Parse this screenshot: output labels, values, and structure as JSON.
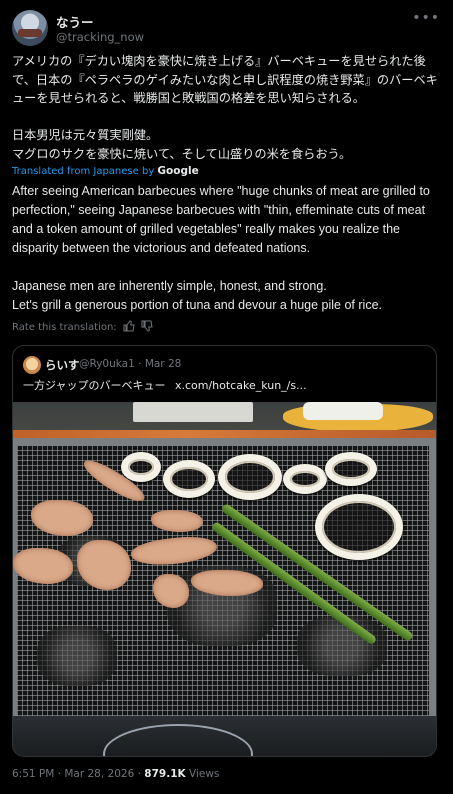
{
  "author": {
    "display_name": "なうー",
    "handle": "@tracking_now",
    "more_icon": "ellipsis-icon"
  },
  "post": {
    "paragraphs": [
      "アメリカの『デカい塊肉を豪快に焼き上げる』バーベキューを見せられた後で、日本の『ペラペラのゲイみたいな肉と申し訳程度の焼き野菜』のバーベキューを見せられると、戦勝国と敗戦国の格差を思い知らされる。",
      "日本男児は元々質実剛健。\nマグロのサクを豪快に焼いて、そして山盛りの米を食らおう。"
    ]
  },
  "translation": {
    "label": "Translated from Japanese by",
    "provider": "Google",
    "paragraphs": [
      "After seeing American barbecues where \"huge chunks of meat are grilled to perfection,\" seeing Japanese barbecues with \"thin, effeminate cuts of meat and a token amount of grilled vegetables\" really makes you realize the disparity between the victorious and defeated nations.",
      "Japanese men are inherently simple, honest, and strong.\nLet's grill a generous portion of tuna and devour a huge pile of rice."
    ],
    "rate_label": "Rate this translation:"
  },
  "quote": {
    "display_name": "らいす",
    "handle": "@Ry0uka1",
    "separator": "·",
    "date": "Mar 28",
    "text": "一方ジャップのバーベキュー",
    "link": "x.com/hotcake_kun_/s..."
  },
  "footer": {
    "time": "6:51 PM",
    "sep1": "·",
    "date": "Mar 28, 2026",
    "sep2": "·",
    "views_count": "879.1K",
    "views_label": "Views"
  }
}
